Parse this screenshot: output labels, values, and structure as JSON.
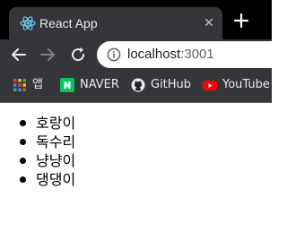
{
  "browser": {
    "tab": {
      "title": "React App",
      "favicon": "react-icon",
      "close_glyph": "✕"
    },
    "new_tab_icon": "plus-icon",
    "address_bar": {
      "host": "localhost",
      "port": ":3001",
      "security_icon": "info-icon"
    },
    "nav": {
      "back_icon": "back-arrow-icon",
      "forward_icon": "forward-arrow-icon",
      "reload_icon": "reload-icon"
    },
    "bookmarks": [
      {
        "label": "앱",
        "icon": "apps-grid-icon"
      },
      {
        "label": "NAVER",
        "icon": "naver-icon"
      },
      {
        "label": "GitHub",
        "icon": "github-icon"
      },
      {
        "label": "YouTube",
        "icon": "youtube-icon"
      }
    ]
  },
  "page": {
    "items": [
      "호랑이",
      "독수리",
      "냥냥이",
      "댕댕이"
    ]
  },
  "colors": {
    "tabstrip": "#000000",
    "toolbar": "#35363a",
    "react": "#61dafb",
    "naver": "#03c75a",
    "youtube": "#ff0000"
  }
}
